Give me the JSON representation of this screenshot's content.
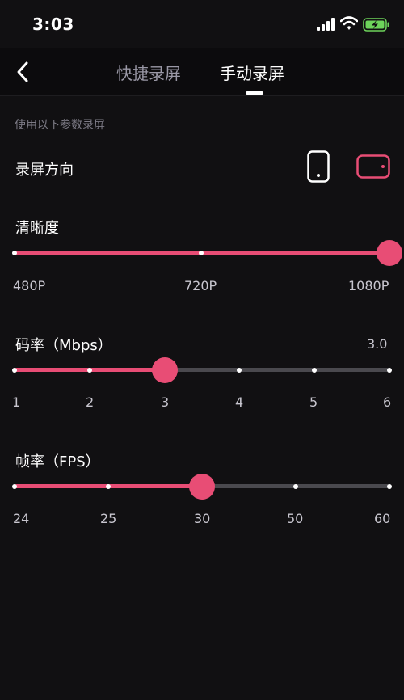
{
  "status_bar": {
    "time": "3:03"
  },
  "nav": {
    "tabs": [
      {
        "label": "快捷录屏",
        "active": false
      },
      {
        "label": "手动录屏",
        "active": true
      }
    ]
  },
  "hint": "使用以下参数录屏",
  "orientation": {
    "label": "录屏方向",
    "options": [
      "portrait",
      "landscape"
    ],
    "selected": "landscape"
  },
  "resolution": {
    "label": "清晰度",
    "ticks": [
      "480P",
      "720P",
      "1080P"
    ],
    "selected": "1080P"
  },
  "bitrate": {
    "label": "码率（Mbps）",
    "value": "3.0",
    "ticks": [
      "1",
      "2",
      "3",
      "4",
      "5",
      "6"
    ],
    "selected": "3"
  },
  "framerate": {
    "label": "帧率（FPS）",
    "ticks": [
      "24",
      "25",
      "30",
      "50",
      "60"
    ],
    "selected": "30"
  },
  "colors": {
    "accent": "#e84d75",
    "background": "#111012",
    "track": "#4a494e"
  }
}
